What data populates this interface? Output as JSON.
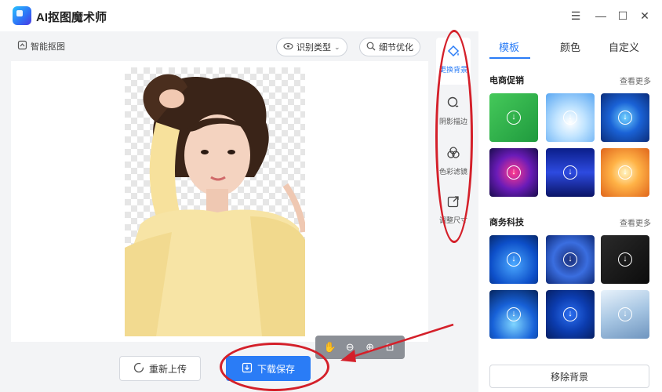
{
  "window": {
    "title": "AI抠图魔术师",
    "controls": [
      "menu-icon",
      "minimize-icon",
      "maximize-icon",
      "close-icon"
    ]
  },
  "canvas": {
    "smart_cutout_label": "智能抠图",
    "detect_type_label": "识别类型",
    "refine_label": "细节优化",
    "zoom_tools": [
      "hand-icon",
      "zoom-out-icon",
      "zoom-in-icon",
      "fit-icon"
    ],
    "reupload_label": "重新上传",
    "download_label": "下载保存"
  },
  "tools": [
    {
      "label": "更换背景",
      "icon": "paint-bucket-icon",
      "active": true
    },
    {
      "label": "阴影描边",
      "icon": "shadow-icon",
      "active": false
    },
    {
      "label": "色彩滤镜",
      "icon": "filter-icon",
      "active": false
    },
    {
      "label": "调整尺寸",
      "icon": "resize-icon",
      "active": false
    }
  ],
  "right_panel": {
    "tabs": [
      {
        "label": "模板",
        "active": true
      },
      {
        "label": "颜色",
        "active": false
      },
      {
        "label": "自定义",
        "active": false
      }
    ],
    "sections": [
      {
        "title": "电商促销",
        "more": "查看更多"
      },
      {
        "title": "商务科技",
        "more": "查看更多"
      }
    ],
    "remove_bg_label": "移除背景"
  },
  "colors": {
    "accent": "#2a7cf6",
    "annotation_red": "#d4202a"
  }
}
